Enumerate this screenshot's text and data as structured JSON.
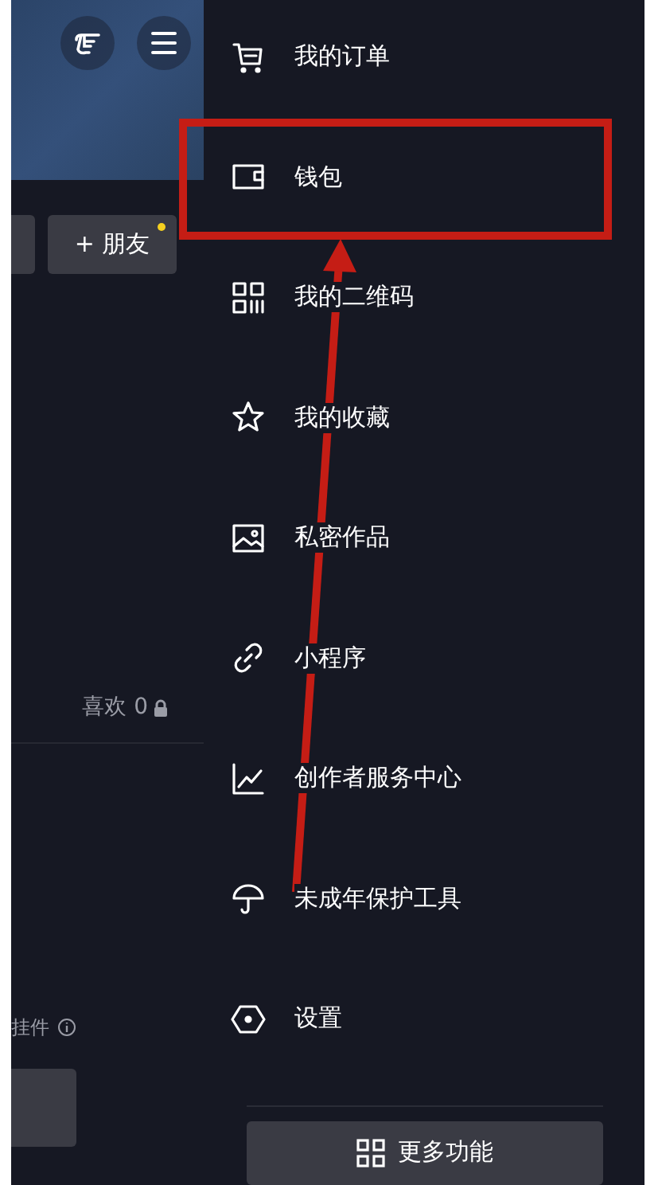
{
  "left_panel": {
    "friend_button": {
      "label": "+ 朋友",
      "new_dot": true
    },
    "likes_tab": {
      "label": "喜欢 0",
      "locked": true
    },
    "widget_label": "挂件"
  },
  "menu": {
    "items": [
      {
        "kind": "cart",
        "label": "我的订单"
      },
      {
        "kind": "wallet",
        "label": "钱包"
      },
      {
        "kind": "qrcode",
        "label": "我的二维码"
      },
      {
        "kind": "star",
        "label": "我的收藏"
      },
      {
        "kind": "image",
        "label": "私密作品"
      },
      {
        "kind": "link",
        "label": "小程序"
      },
      {
        "kind": "chart",
        "label": "创作者服务中心"
      },
      {
        "kind": "umbrella",
        "label": "未成年保护工具"
      },
      {
        "kind": "settings",
        "label": "设置"
      }
    ],
    "more_button": {
      "kind": "grid",
      "label": "更多功能"
    }
  }
}
